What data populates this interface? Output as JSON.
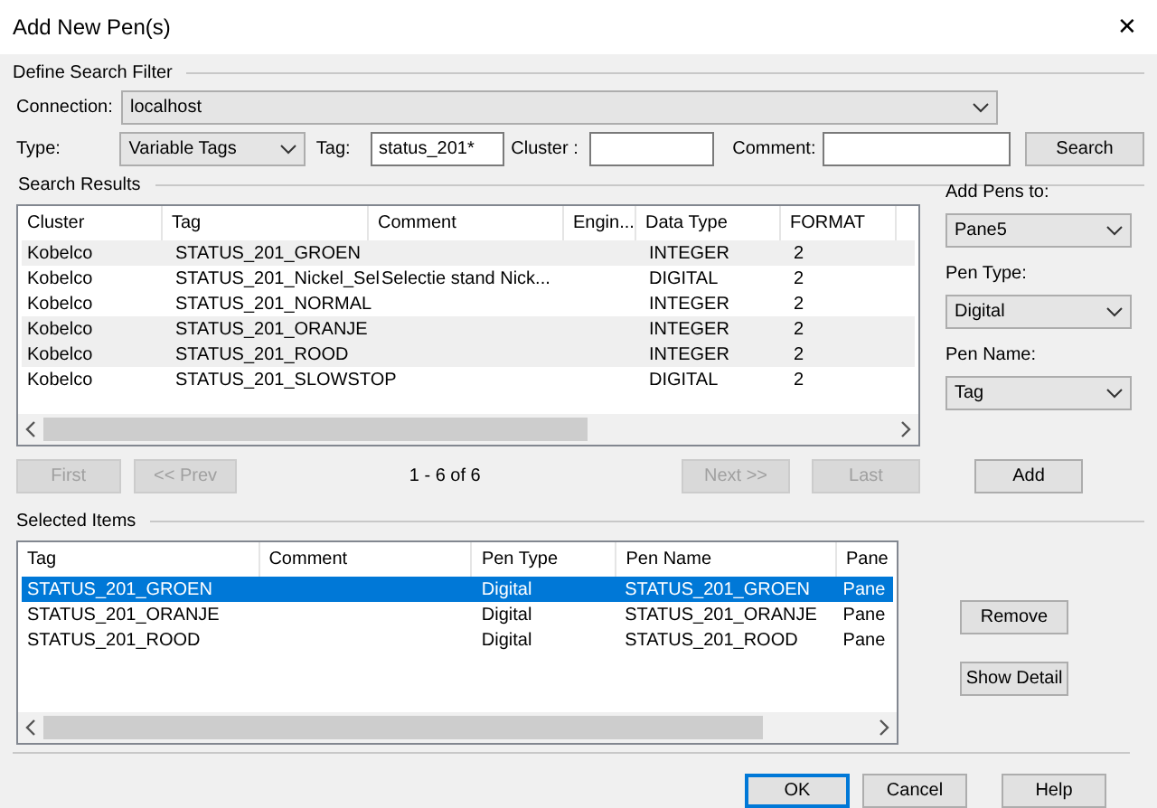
{
  "window": {
    "title": "Add New Pen(s)",
    "close": "✕"
  },
  "filter": {
    "title": "Define Search Filter",
    "connection_label": "Connection:",
    "connection": "localhost",
    "type_label": "Type:",
    "type": "Variable Tags",
    "tag_label": "Tag:",
    "tag": "status_201*",
    "cluster_label": "Cluster :",
    "comment_label": "Comment:",
    "search_button": "Search"
  },
  "results": {
    "title": "Search Results",
    "columns": [
      "Cluster",
      "Tag",
      "Comment",
      "Engin...",
      "Data Type",
      "FORMAT"
    ],
    "rows": [
      {
        "cells": [
          "Kobelco",
          "STATUS_201_GROEN",
          "",
          "",
          "INTEGER",
          "2"
        ],
        "shaded": true
      },
      {
        "cells": [
          "Kobelco",
          "STATUS_201_Nickel_Sel",
          "Selectie stand Nick...",
          "",
          "DIGITAL",
          "2"
        ],
        "shaded": false
      },
      {
        "cells": [
          "Kobelco",
          "STATUS_201_NORMAL",
          "",
          "",
          "INTEGER",
          "2"
        ],
        "shaded": false
      },
      {
        "cells": [
          "Kobelco",
          "STATUS_201_ORANJE",
          "",
          "",
          "INTEGER",
          "2"
        ],
        "shaded": true
      },
      {
        "cells": [
          "Kobelco",
          "STATUS_201_ROOD",
          "",
          "",
          "INTEGER",
          "2"
        ],
        "shaded": true
      },
      {
        "cells": [
          "Kobelco",
          "STATUS_201_SLOWSTOP",
          "",
          "",
          "DIGITAL",
          "2"
        ],
        "shaded": false
      }
    ],
    "pager": [
      {
        "label": "First",
        "disabled": true
      },
      {
        "label": "<< Prev",
        "disabled": true
      },
      {
        "label": "Next >>",
        "disabled": true
      },
      {
        "label": "Last",
        "disabled": true
      }
    ],
    "page_info": "1 - 6 of 6"
  },
  "options": [
    {
      "label": "Add Pens to:",
      "value": "Pane5"
    },
    {
      "label": "Pen Type:",
      "value": "Digital"
    },
    {
      "label": "Pen Name:",
      "value": "Tag"
    }
  ],
  "add_button": "Add",
  "selected": {
    "title": "Selected Items",
    "columns": [
      "Tag",
      "Comment",
      "Pen Type",
      "Pen Name",
      "Pane"
    ],
    "rows": [
      {
        "cells": [
          "STATUS_201_GROEN",
          "",
          "Digital",
          "STATUS_201_GROEN",
          "Pane"
        ],
        "selected": true
      },
      {
        "cells": [
          "STATUS_201_ORANJE",
          "",
          "Digital",
          "STATUS_201_ORANJE",
          "Pane"
        ],
        "selected": false
      },
      {
        "cells": [
          "STATUS_201_ROOD",
          "",
          "Digital",
          "STATUS_201_ROOD",
          "Pane"
        ],
        "selected": false
      }
    ]
  },
  "side_buttons": [
    "Remove",
    "Show Detail"
  ],
  "footer_buttons": [
    {
      "label": "OK",
      "default": true
    },
    {
      "label": "Cancel",
      "default": false
    },
    {
      "label": "Help",
      "default": false
    }
  ]
}
